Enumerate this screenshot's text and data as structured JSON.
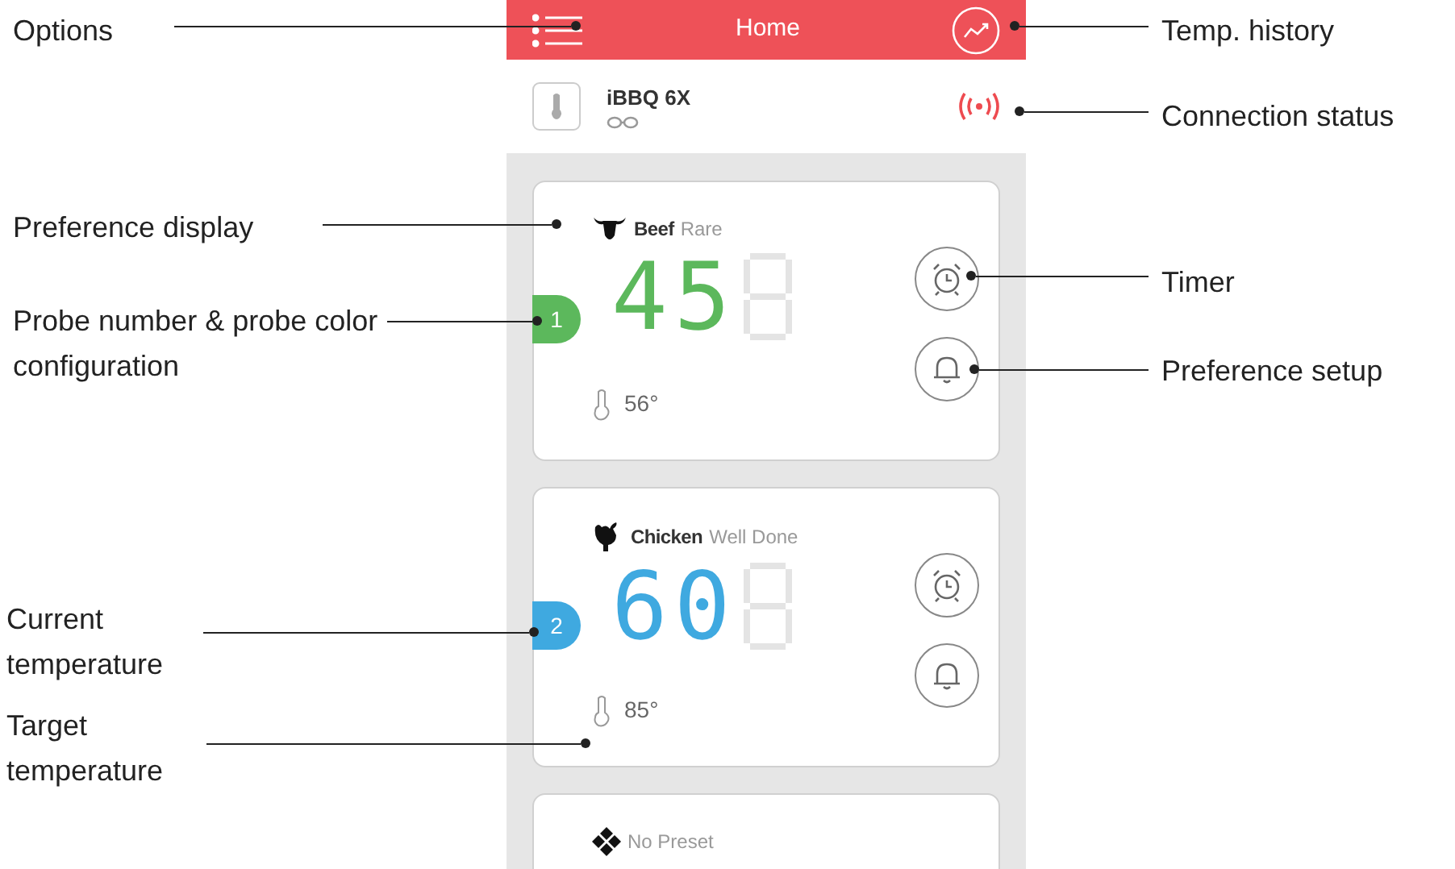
{
  "header": {
    "title": "Home"
  },
  "device": {
    "name": "iBBQ 6X"
  },
  "probes": [
    {
      "kind": "beef",
      "number": "1",
      "color": "#5cb85c",
      "food": "Beef",
      "doneness": "Rare",
      "reading": "45",
      "target": "56°"
    },
    {
      "kind": "chicken",
      "number": "2",
      "color": "#3fa9e0",
      "food": "Chicken",
      "doneness": "Well Done",
      "reading": "60",
      "target": "85°"
    },
    {
      "kind": "none",
      "food": "No Preset"
    }
  ],
  "callouts": [
    {
      "text": "Options"
    },
    {
      "text": "Preference display"
    },
    {
      "text": "Probe number & probe color configuration"
    },
    {
      "text": "Current temperature"
    },
    {
      "text": "Target temperature"
    },
    {
      "text": "Temp. history"
    },
    {
      "text": "Connection status"
    },
    {
      "text": "Timer"
    },
    {
      "text": "Preference setup"
    }
  ]
}
